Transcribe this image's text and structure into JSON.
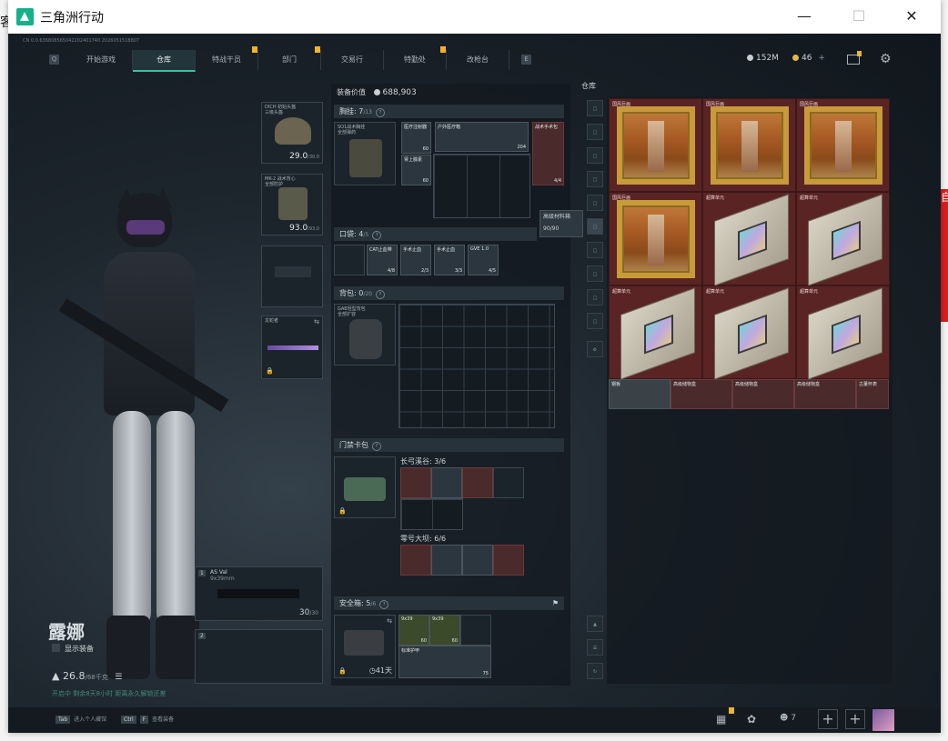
{
  "window": {
    "title": "三角洲行动"
  },
  "behind": {
    "left_chars": [
      "客",
      "角",
      "P",
      "星"
    ],
    "right_chars": [
      "自",
      "部",
      "是",
      "成"
    ]
  },
  "game": {
    "build_id": "CN  0.0.636808565042202401740  2026051518807",
    "nav": {
      "tabs": [
        "开始游戏",
        "仓库",
        "特战干员",
        "部门",
        "交易行",
        "特勤处",
        "改枪台"
      ],
      "active": "仓库",
      "left_key": "Q",
      "right_key": "E"
    },
    "currency": {
      "money": "152M",
      "tokens": "46",
      "plus": "+"
    },
    "operator": {
      "name": "露娜",
      "show_gear_label": "显示装备",
      "weight": "26.8",
      "weight_max": "/68千克",
      "footer_note": "开启中  剩余8天8小时 距离永久解锁还差"
    },
    "equipment": {
      "helmet": {
        "label": "DICH 初始头盔",
        "sub": "三级头盔",
        "durability": "29.0",
        "max": "/30.0"
      },
      "armor": {
        "label": "MK-2 战术背心",
        "sub": "全部防护",
        "durability": "93.0",
        "max": "/93.0"
      },
      "melee": {
        "label": "龙蛇者"
      },
      "primary": {
        "slot": "1",
        "name": "AS Val",
        "caliber": "9x39mm",
        "ammo": "30",
        "ammo_max": "/30"
      },
      "secondary": {
        "slot": "2"
      }
    },
    "loadout": {
      "value_label": "装备价值",
      "value": "688,903",
      "chest": {
        "label": "胸挂",
        "count": "7",
        "cap": "/13",
        "rig_name": "SO1战术胸挂",
        "rig_sub": "全部弹药",
        "items": [
          {
            "name": "医疗注射器",
            "count": "60"
          },
          {
            "name": "肾上腺素",
            "count": "60"
          },
          {
            "name": "户外医疗箱",
            "count": "204"
          },
          {
            "name": "战术手术包",
            "count": "4/4"
          }
        ]
      },
      "pocket": {
        "label": "口袋",
        "count": "4",
        "cap": "/5",
        "items": [
          {
            "name": "CAT止血带",
            "count": "4/8"
          },
          {
            "name": "手术止血",
            "count": "2/3"
          },
          {
            "name": "手术止血",
            "count": "3/3"
          },
          {
            "name": "GVE 1.0",
            "count": "4/5"
          }
        ]
      },
      "backpack": {
        "label": "背包",
        "count": "0",
        "cap": "/20",
        "pack_name": "GAB轻型背包",
        "pack_sub": "全部扩容"
      },
      "keycase": {
        "label": "门禁卡包",
        "group1": "长弓溪谷: 3/6",
        "group2": "零号大坝: 6/6"
      },
      "secure": {
        "label": "安全箱",
        "count": "5",
        "cap": "/6",
        "days": "41天",
        "items": [
          {
            "name": "9x39",
            "count": "60"
          },
          {
            "name": "9x39",
            "count": "60"
          },
          {
            "name": "标准护甲",
            "count": "75"
          }
        ]
      },
      "tooltip": {
        "name": "高级材料箱",
        "value": "90/90"
      }
    },
    "warehouse": {
      "title": "仓库",
      "cells": [
        "国风巨画",
        "国风巨画",
        "国风巨画",
        "国风巨画",
        "超算单元",
        "超算单元",
        "超算单元",
        "超算单元",
        "超算单元"
      ],
      "small_items": [
        "钢板",
        "高级储物盒",
        "高级储物盒",
        "高级储物盒",
        "古董怀表"
      ]
    },
    "bottom": {
      "hint1_key": "Tab",
      "hint1": "进入个人藏馆",
      "hint2_key": "Ctrl",
      "hint2": "查看装备",
      "hint2_key2": "F",
      "friends": "7"
    }
  }
}
